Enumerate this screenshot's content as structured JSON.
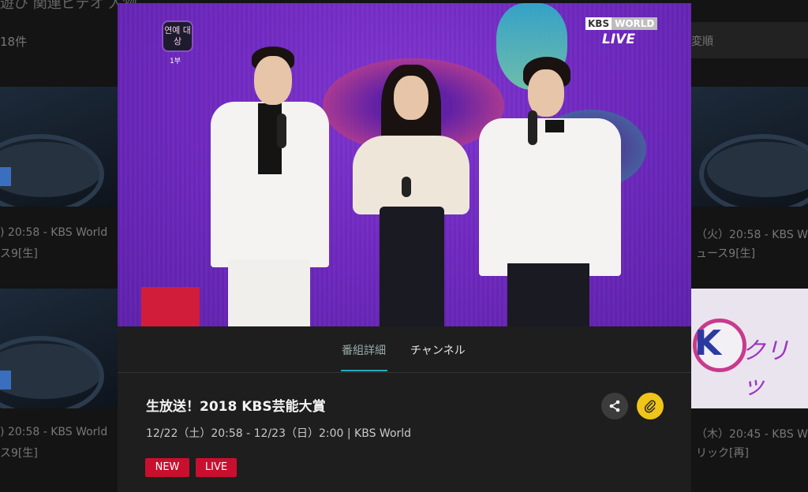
{
  "background": {
    "heading": "遊び 関連ビデオ 人物",
    "count": "18件",
    "sort_label": "変順",
    "rows": [
      {
        "left_meta": ") 20:58 - KBS World",
        "left_title": "ス9[生]",
        "right_meta": "（火）20:58 - KBS W",
        "right_title": "ュース9[生]"
      },
      {
        "left_meta": ") 20:58 - KBS World",
        "left_title": "ス9[生]",
        "right_meta": "（木）20:45 - KBS W",
        "right_title": "リック[再]"
      }
    ],
    "kbs_clip": {
      "k": "K",
      "text": "クリッ"
    }
  },
  "modal": {
    "video": {
      "channel_logo_text": "연예\n대상",
      "channel_logo_sub": "1부",
      "broadcaster_kbs": "KBS",
      "broadcaster_world": "WORLD",
      "live_text": "LIVE"
    },
    "tabs": [
      {
        "label": "番組詳細",
        "active": true
      },
      {
        "label": "チャンネル",
        "active": false
      }
    ],
    "program": {
      "title": "生放送！2018 KBS芸能大賞",
      "time": "12/22（土）20:58 - 12/23（日）2:00 | KBS World",
      "badges": [
        "NEW",
        "LIVE"
      ]
    },
    "actions": {
      "share_icon": "share-icon",
      "clip_icon": "paperclip-icon"
    }
  },
  "colors": {
    "accent": "#2aa8c4",
    "badge": "#c8102e",
    "clip_button": "#f0c419"
  }
}
